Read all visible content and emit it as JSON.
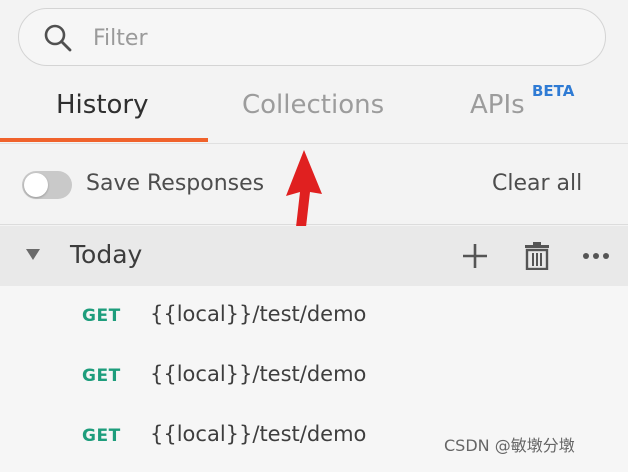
{
  "filter": {
    "placeholder": "Filter"
  },
  "tabs": {
    "history": "History",
    "collections": "Collections",
    "apis": "APIs",
    "apis_badge": "BETA"
  },
  "save_row": {
    "label": "Save Responses",
    "clear": "Clear all",
    "toggle_on": false
  },
  "group": {
    "title": "Today"
  },
  "history_items": [
    {
      "method": "GET",
      "url": "{{local}}/test/demo"
    },
    {
      "method": "GET",
      "url": "{{local}}/test/demo"
    },
    {
      "method": "GET",
      "url": "{{local}}/test/demo"
    }
  ],
  "watermark": "CSDN @敏墩分墩",
  "colors": {
    "active_tab_underline": "#f0622b",
    "beta_badge": "#2f7bd4",
    "method_get": "#1e9d7c",
    "annotation_arrow": "#e02020"
  }
}
